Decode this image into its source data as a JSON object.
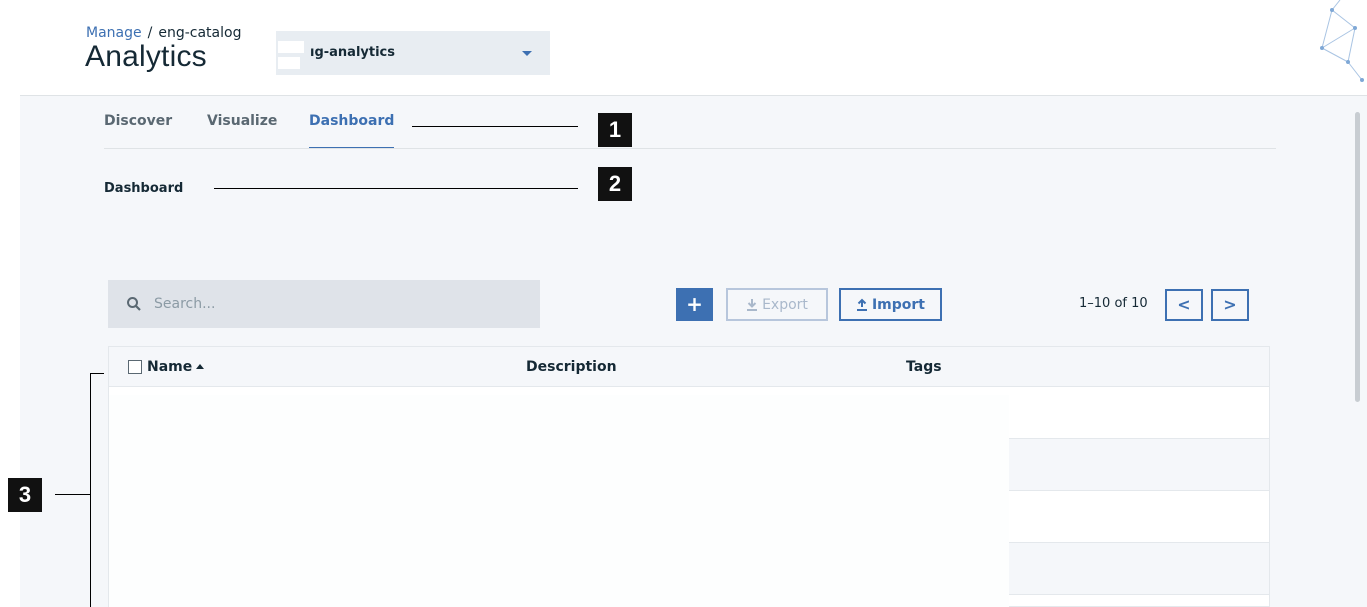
{
  "breadcrumb": {
    "parent": "Manage",
    "separator": "/",
    "current": "eng-catalog"
  },
  "page_title": "Analytics",
  "space_selector": {
    "value": "ıg-analytics"
  },
  "tabs": [
    {
      "label": "Discover",
      "active": false
    },
    {
      "label": "Visualize",
      "active": false
    },
    {
      "label": "Dashboard",
      "active": true
    }
  ],
  "section_title": "Dashboard",
  "callouts": [
    "1",
    "2",
    "3"
  ],
  "toolbar": {
    "search_placeholder": "Search...",
    "add_label": "+",
    "export_label": "Export",
    "import_label": "Import"
  },
  "pagination": {
    "range_text": "1–10 of 10",
    "prev": "<",
    "next": ">"
  },
  "table": {
    "columns": [
      "Name",
      "Description",
      "Tags"
    ],
    "sort_column": "Name",
    "sort_direction": "ascending"
  },
  "colors": {
    "accent": "#3d70b2",
    "panel_bg": "#f5f7fa",
    "search_bg": "#dfe3e9"
  }
}
